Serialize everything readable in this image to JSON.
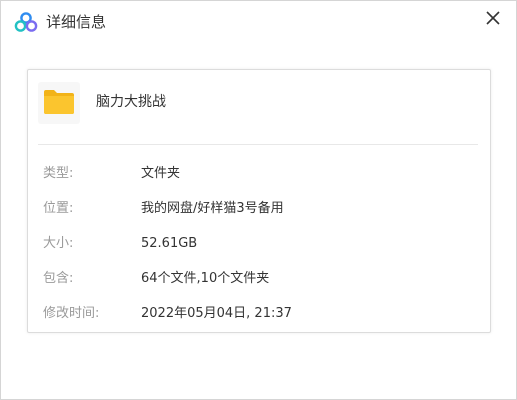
{
  "window": {
    "title": "详细信息",
    "app_icon": "baidu-netdisk-cloud-icon",
    "close_icon": "close-icon"
  },
  "item": {
    "icon": "folder-icon",
    "name": "脑力大挑战"
  },
  "details": [
    {
      "label": "类型:",
      "value": "文件夹"
    },
    {
      "label": "位置:",
      "value": "我的网盘/好样猫3号备用"
    },
    {
      "label": "大小:",
      "value": "52.61GB"
    },
    {
      "label": "包含:",
      "value": "64个文件,10个文件夹"
    },
    {
      "label": "修改时间:",
      "value": "2022年05月04日, 21:37"
    }
  ],
  "colors": {
    "folder": "#fbc52e",
    "app_icon_blue": "#2f8cf0",
    "app_icon_teal": "#22c1c3",
    "app_icon_purple": "#7a6cf0"
  }
}
